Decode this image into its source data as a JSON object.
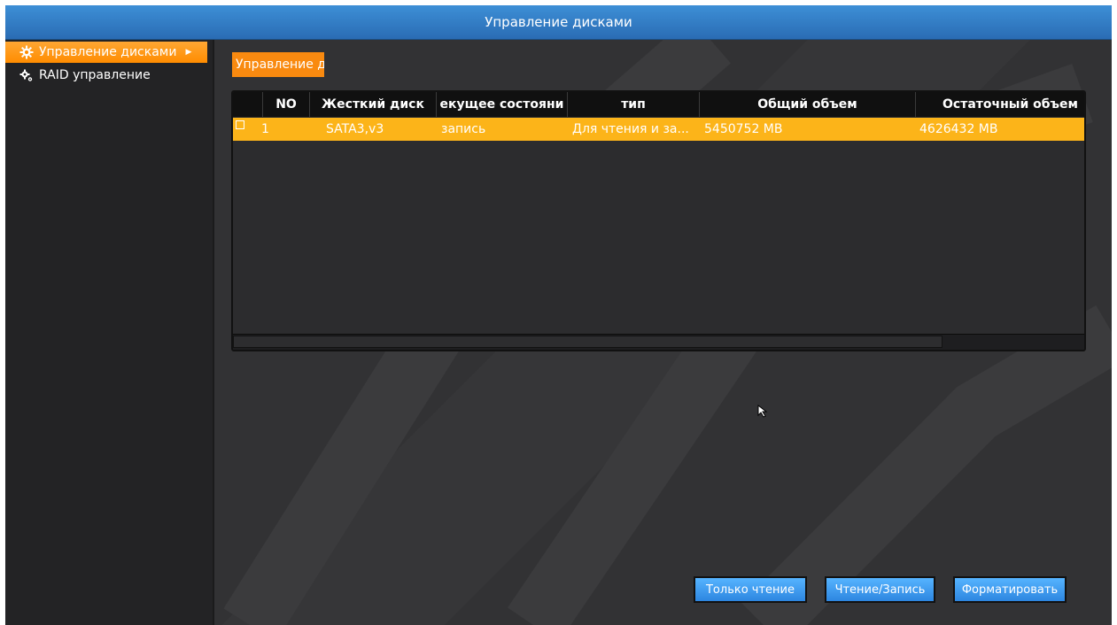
{
  "window": {
    "title": "Управление дисками"
  },
  "sidebar": {
    "items": [
      {
        "label": "Управление дисками",
        "active": true,
        "icon": "gear-icon"
      },
      {
        "label": "RAID управление",
        "active": false,
        "icon": "gears-icon"
      }
    ]
  },
  "tab": {
    "label": "Управление д"
  },
  "table": {
    "columns": [
      "NO",
      "Жесткий диск",
      "екущее состояни",
      "тип",
      "Общий объем",
      "Остаточный объем"
    ],
    "rows": [
      {
        "checked": false,
        "no": "1",
        "disk": "SATA3,v3",
        "state": "запись",
        "type": "Для чтения и за...",
        "total": "5450752 MB",
        "remaining": "4626432 MB"
      }
    ]
  },
  "buttons": {
    "read_only": "Только чтение",
    "read_write": "Чтение/Запись",
    "format": "Форматировать"
  },
  "colors": {
    "titlebar": "#2a6cb4",
    "accent_orange": "#ff8c00",
    "selected_row": "#fcb419",
    "button_blue": "#3d9af0",
    "background": "#323234"
  }
}
